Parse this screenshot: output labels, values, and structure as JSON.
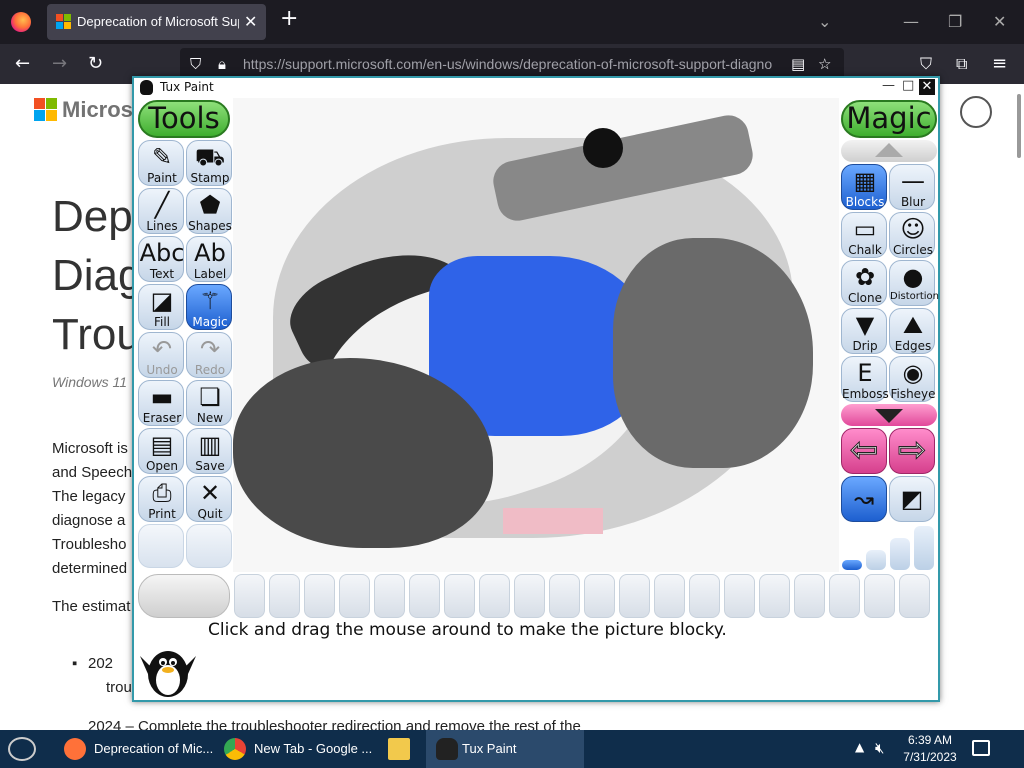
{
  "browser": {
    "tab_title": "Deprecation of Microsoft Support",
    "new_tab_symbol": "+",
    "url": "https://support.microsoft.com/en-us/windows/deprecation-of-microsoft-support-diagno"
  },
  "page": {
    "brand": "Microsoft",
    "title_lines": [
      "Dep",
      "Diag",
      "Trou"
    ],
    "meta": "Windows 11",
    "paragraph_lines": [
      "Microsoft is",
      "and Speech",
      "The legacy",
      "diagnose a",
      "Troublesho",
      "determined"
    ],
    "estimate": "The estimat",
    "list_item_1_lines": [
      "202",
      "trou"
    ],
    "list_item_2": "2024 – Complete the troubleshooter redirection and remove the rest of the"
  },
  "tuxpaint": {
    "window_title": "Tux Paint",
    "tools_title": "Tools",
    "magic_title": "Magic",
    "tools": [
      {
        "label": "Paint",
        "icon": "✎"
      },
      {
        "label": "Stamp",
        "icon": "⛟"
      },
      {
        "label": "Lines",
        "icon": "╱"
      },
      {
        "label": "Shapes",
        "icon": "⬟"
      },
      {
        "label": "Text",
        "icon": "Abc"
      },
      {
        "label": "Label",
        "icon": "Ab"
      },
      {
        "label": "Fill",
        "icon": "◪"
      },
      {
        "label": "Magic",
        "icon": "⚚"
      },
      {
        "label": "Undo",
        "icon": "↶"
      },
      {
        "label": "Redo",
        "icon": "↷"
      },
      {
        "label": "Eraser",
        "icon": "▬"
      },
      {
        "label": "New",
        "icon": "❏"
      },
      {
        "label": "Open",
        "icon": "▤"
      },
      {
        "label": "Save",
        "icon": "▥"
      },
      {
        "label": "Print",
        "icon": "⎙"
      },
      {
        "label": "Quit",
        "icon": "✕"
      }
    ],
    "magic_tools": [
      {
        "label": "Blocks",
        "icon": "▦"
      },
      {
        "label": "Blur",
        "icon": "—"
      },
      {
        "label": "Chalk",
        "icon": "▭"
      },
      {
        "label": "Circles",
        "icon": "☺"
      },
      {
        "label": "Clone",
        "icon": "✿"
      },
      {
        "label": "Distortion",
        "icon": "●"
      },
      {
        "label": "Drip",
        "icon": "▼"
      },
      {
        "label": "Edges",
        "icon": "⛰"
      },
      {
        "label": "Emboss",
        "icon": "E"
      },
      {
        "label": "Fisheye",
        "icon": "◉"
      }
    ],
    "status": "Click and drag the mouse around to make the picture blocky."
  },
  "taskbar": {
    "tasks": [
      {
        "label": "Deprecation of Mic...",
        "color": "#ff7139"
      },
      {
        "label": "New Tab - Google ...",
        "color": "#34a853"
      },
      {
        "label": "",
        "color": "#f2c94c"
      },
      {
        "label": "Tux Paint",
        "color": "#222222"
      }
    ],
    "time": "6:39 AM",
    "date": "7/31/2023"
  }
}
